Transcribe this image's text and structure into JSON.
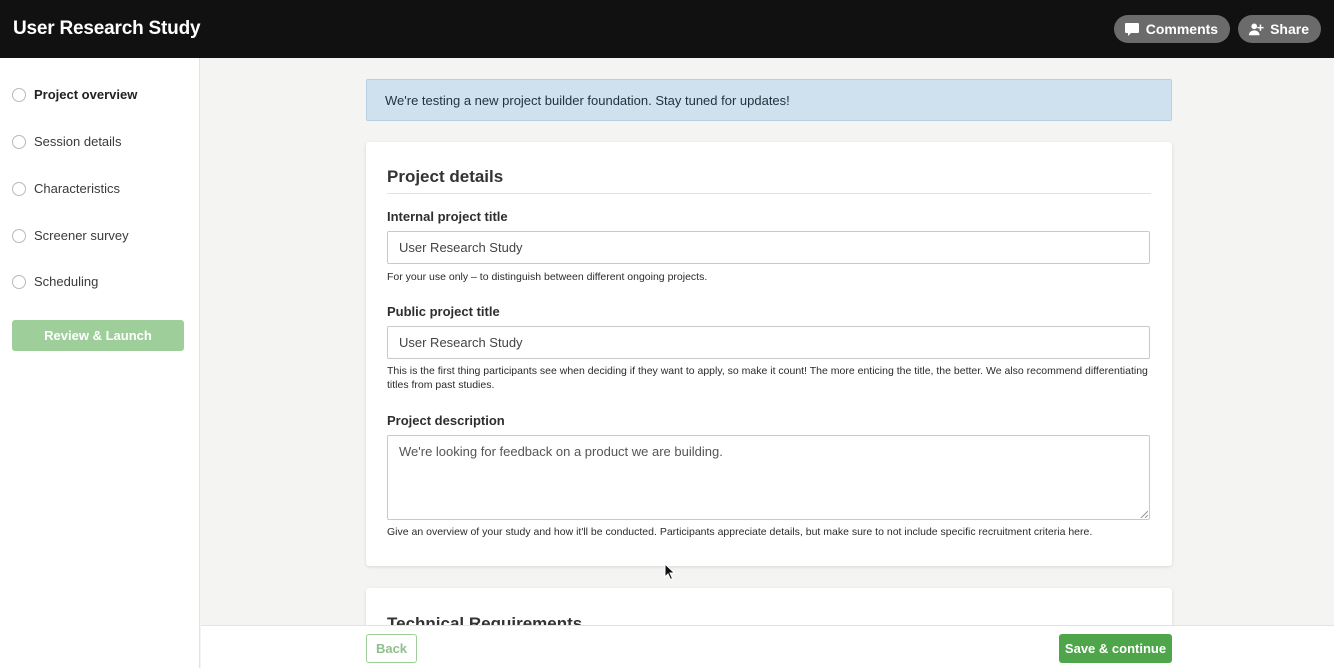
{
  "header": {
    "title": "User Research Study",
    "comments_label": "Comments",
    "share_label": "Share"
  },
  "sidebar": {
    "steps": [
      {
        "label": "Project overview",
        "active": true
      },
      {
        "label": "Session details",
        "active": false
      },
      {
        "label": "Characteristics",
        "active": false
      },
      {
        "label": "Screener survey",
        "active": false
      },
      {
        "label": "Scheduling",
        "active": false
      }
    ],
    "launch_label": "Review & Launch"
  },
  "banner": {
    "text": "We're testing a new project builder foundation. Stay tuned for updates!"
  },
  "project_details": {
    "title": "Project details",
    "internal_title": {
      "label": "Internal project title",
      "value": "User Research Study",
      "help": "For your use only – to distinguish between different ongoing projects."
    },
    "public_title": {
      "label": "Public project title",
      "value": "User Research Study",
      "help": "This is the first thing participants see when deciding if they want to apply, so make it count! The more enticing the title, the better. We also recommend differentiating titles from past studies."
    },
    "description": {
      "label": "Project description",
      "value": "We're looking for feedback on a product we are building.",
      "help": "Give an overview of your study and how it'll be conducted. Participants appreciate details, but make sure to not include specific recruitment criteria here."
    }
  },
  "technical": {
    "title": "Technical Requirements"
  },
  "footer": {
    "back_label": "Back",
    "save_label": "Save & continue"
  },
  "colors": {
    "primary_green": "#4ea54a",
    "disabled_green": "#9ecf9b",
    "banner_blue": "#cfe1ef",
    "topbar": "#111111"
  }
}
